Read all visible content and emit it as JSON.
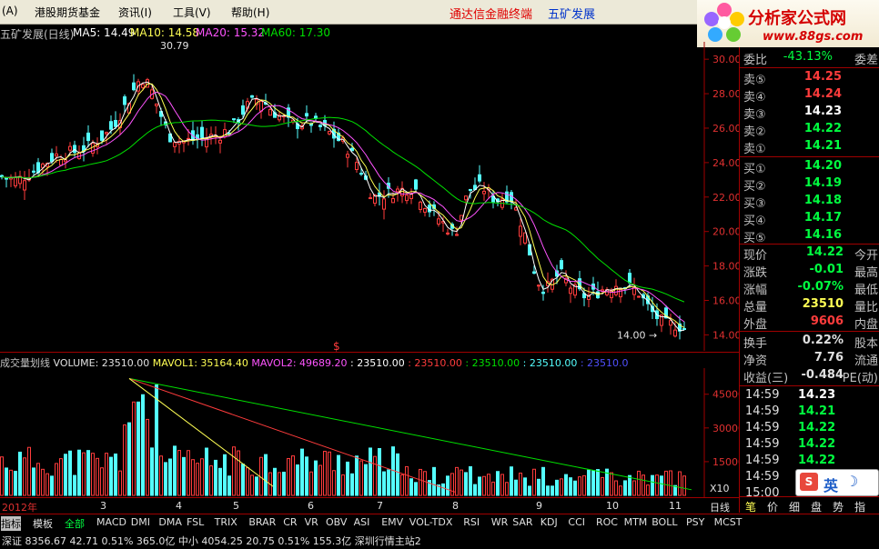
{
  "menu": {
    "items": [
      "港股期货基金",
      "资讯(I)",
      "工具(V)",
      "帮助(H)"
    ],
    "first": "(A)",
    "promo": "通达信金融终端",
    "stock_title": "五矿发展"
  },
  "logo": {
    "name": "分析家公式网",
    "url": "www.88gs.com"
  },
  "chart": {
    "title": "五矿发展(日线)",
    "ma5": "MA5: 14.49",
    "ma10": "MA10: 14.58",
    "ma20": "MA20: 15.32",
    "ma60": "MA60: 17.30",
    "high_label": "30.79",
    "low_label": "14.00",
    "y_ticks": [
      "30.00",
      "28.00",
      "26.00",
      "24.00",
      "22.00",
      "20.00",
      "18.00",
      "16.00",
      "14.00"
    ],
    "colors": {
      "up": "#ff3c3c",
      "down": "#54ffff",
      "ma5": "#ffffff",
      "ma10": "#ffff54",
      "ma20": "#ff54ff",
      "ma60": "#00e000"
    }
  },
  "volume": {
    "header": "成交量划线 VOLUME: 23510.00 MAVOL1: 35164.40 MAVOL2: 49689.20 : 23510.00 : 23510.00 : 23510.00 : 23510.00 : 23510.00 : 23510.0",
    "title": "成交量划线",
    "volume": "VOLUME: 23510.00",
    "mavol1": "MAVOL1: 35164.40",
    "mavol2": "MAVOL2: 49689.20",
    "extra": [
      ": 23510.00",
      ": 23510.00",
      ": 23510.00",
      ": 23510.00",
      ": 23510.0"
    ],
    "y_ticks": [
      "45000",
      "30000",
      "15000",
      "X10"
    ]
  },
  "x_axis": {
    "labels": [
      "2012年",
      "3",
      "4",
      "5",
      "6",
      "7",
      "8",
      "9",
      "10",
      "11"
    ],
    "period": "日线"
  },
  "quote": {
    "weibi": {
      "k": "委比",
      "v": "-43.13%",
      "k2": "委差"
    },
    "sells": [
      {
        "k": "卖⑤",
        "v": "14.25"
      },
      {
        "k": "卖④",
        "v": "14.24"
      },
      {
        "k": "卖③",
        "v": "14.23"
      },
      {
        "k": "卖②",
        "v": "14.22"
      },
      {
        "k": "卖①",
        "v": "14.21"
      }
    ],
    "buys": [
      {
        "k": "买①",
        "v": "14.20"
      },
      {
        "k": "买②",
        "v": "14.19"
      },
      {
        "k": "买③",
        "v": "14.18"
      },
      {
        "k": "买④",
        "v": "14.17"
      },
      {
        "k": "买⑤",
        "v": "14.16"
      }
    ],
    "stats": [
      {
        "k": "现价",
        "v": "14.22",
        "k2": "今开"
      },
      {
        "k": "涨跌",
        "v": "-0.01",
        "k2": "最高"
      },
      {
        "k": "涨幅",
        "v": "-0.07%",
        "k2": "最低"
      },
      {
        "k": "总量",
        "v": "23510",
        "k2": "量比"
      },
      {
        "k": "外盘",
        "v": "9606",
        "k2": "内盘"
      }
    ],
    "stats2": [
      {
        "k": "换手",
        "v": "0.22%",
        "k2": "股本"
      },
      {
        "k": "净资",
        "v": "7.76",
        "k2": "流通"
      },
      {
        "k": "收益(三)",
        "v": "-0.484",
        "k2": "PE(动)"
      }
    ],
    "ticks": [
      {
        "t": "14:59",
        "p": "14.23"
      },
      {
        "t": "14:59",
        "p": "14.21"
      },
      {
        "t": "14:59",
        "p": "14.22"
      },
      {
        "t": "14:59",
        "p": "14.22"
      },
      {
        "t": "14:59",
        "p": "14.22"
      },
      {
        "t": "14:59",
        "p": "14.22"
      },
      {
        "t": "15:00",
        "p": "14.22"
      }
    ],
    "tabs": [
      "笔",
      "价",
      "细",
      "盘",
      "势",
      "指"
    ]
  },
  "indicator_tabs": [
    "指标",
    "模板",
    "全部",
    "MACD",
    "DMI",
    "DMA",
    "FSL",
    "TRIX",
    "BRAR",
    "CR",
    "VR",
    "OBV",
    "ASI",
    "EMV",
    "VOL-TDX",
    "RSI",
    "WR",
    "SAR",
    "KDJ",
    "CCI",
    "ROC",
    "MTM",
    "BOLL",
    "PSY",
    "MCST"
  ],
  "status": "深证 8356.67  42.71  0.51%  365.0亿  中小 4054.25  20.75  0.51%  155.3亿  深圳行情主站2",
  "ime": {
    "label": "英"
  }
}
